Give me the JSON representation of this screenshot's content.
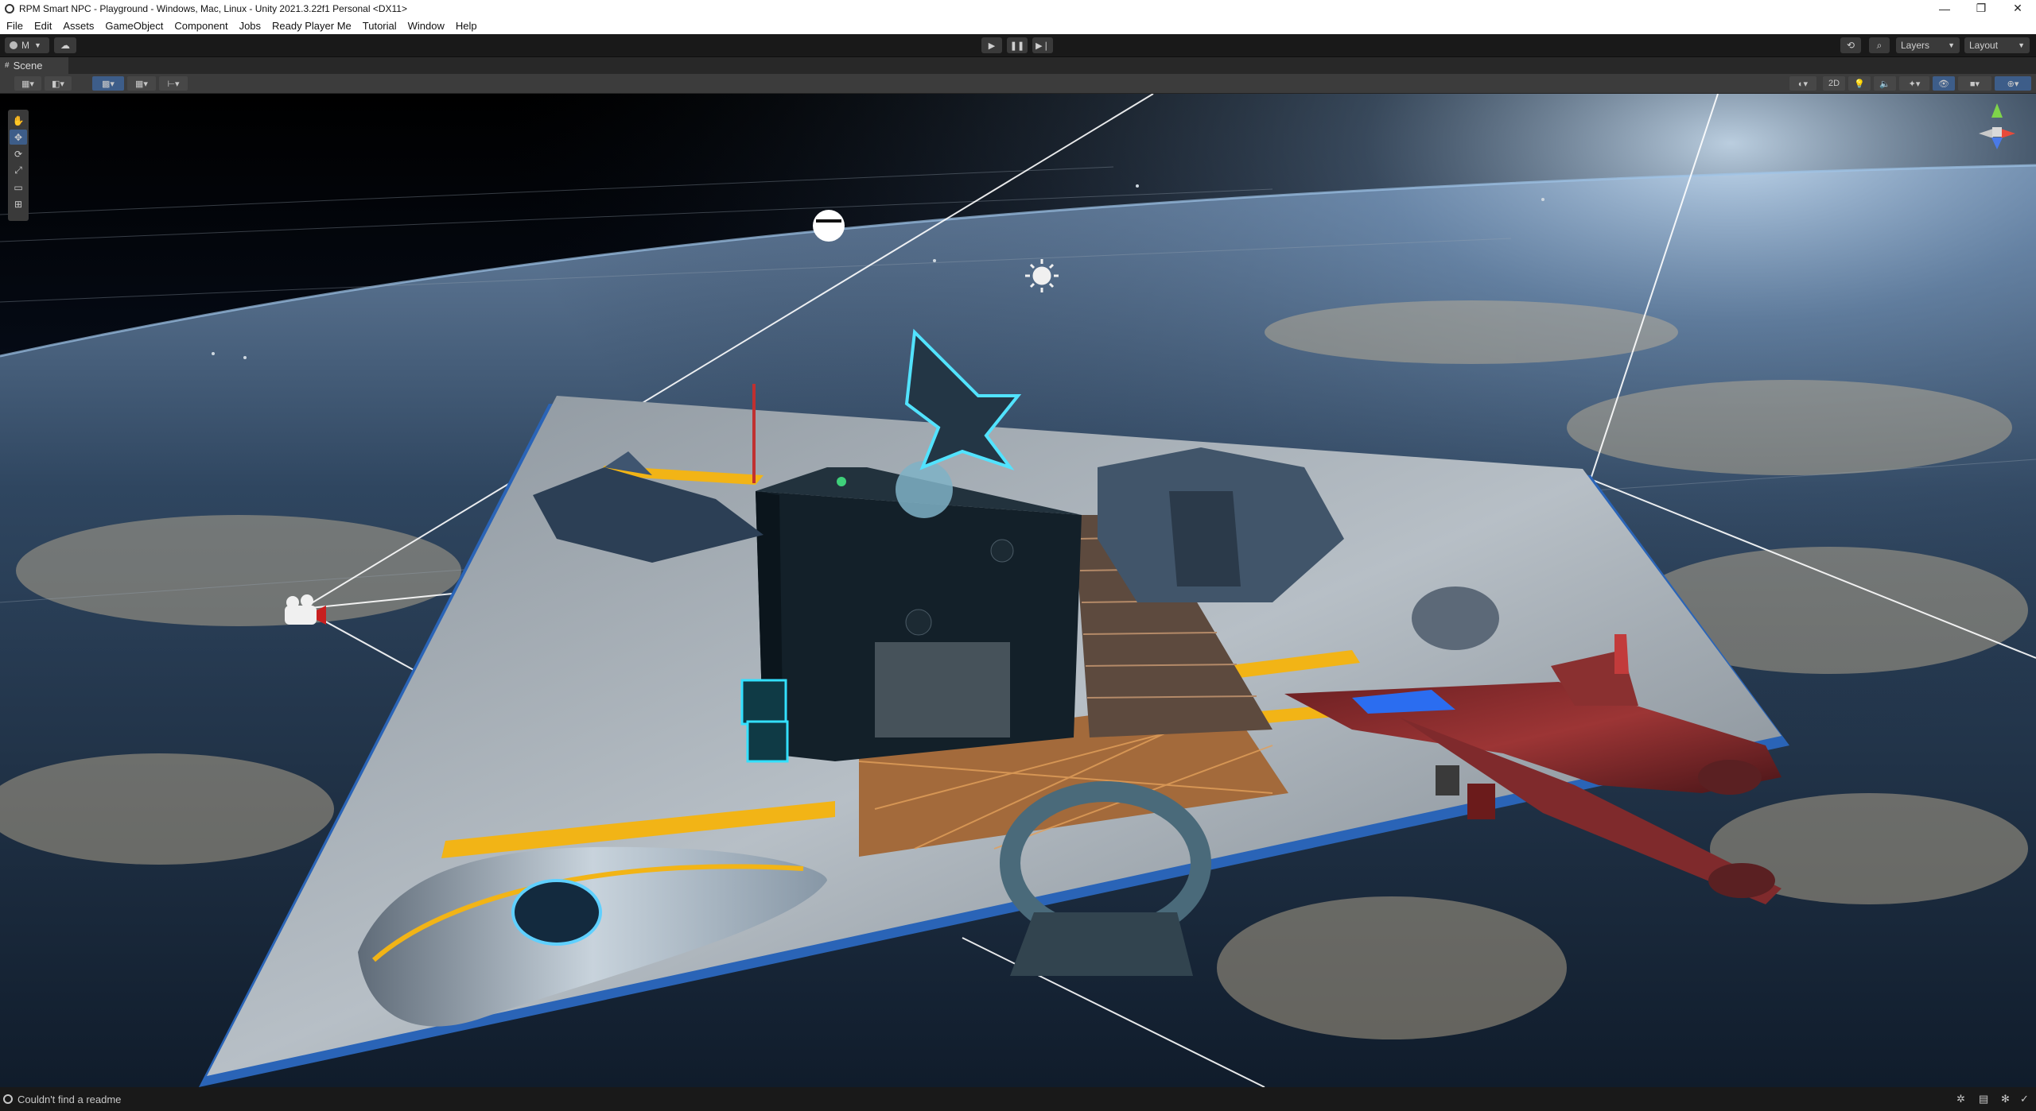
{
  "window": {
    "title": "RPM Smart NPC - Playground - Windows, Mac, Linux - Unity 2021.3.22f1 Personal <DX11>",
    "controls": {
      "minimize": "—",
      "restore": "❐",
      "close": "✕"
    }
  },
  "menu": [
    "File",
    "Edit",
    "Assets",
    "GameObject",
    "Component",
    "Jobs",
    "Ready Player Me",
    "Tutorial",
    "Window",
    "Help"
  ],
  "toolbar": {
    "account_label": "M",
    "play_icon": "play-icon",
    "pause_icon": "pause-icon",
    "step_icon": "step-icon",
    "layers_label": "Layers",
    "layout_label": "Layout"
  },
  "scene_tab": {
    "label": "Scene"
  },
  "scene_toolbar": {
    "mode_2d_label": "2D"
  },
  "status": {
    "message": "Couldn't find a readme"
  },
  "colors": {
    "editor_bg": "#191919",
    "panel": "#3c3c3c",
    "accent": "#3d5d89",
    "sky": "#05070b",
    "stripe_yellow": "#f2b416",
    "platform_edge": "#3a8ee8"
  }
}
